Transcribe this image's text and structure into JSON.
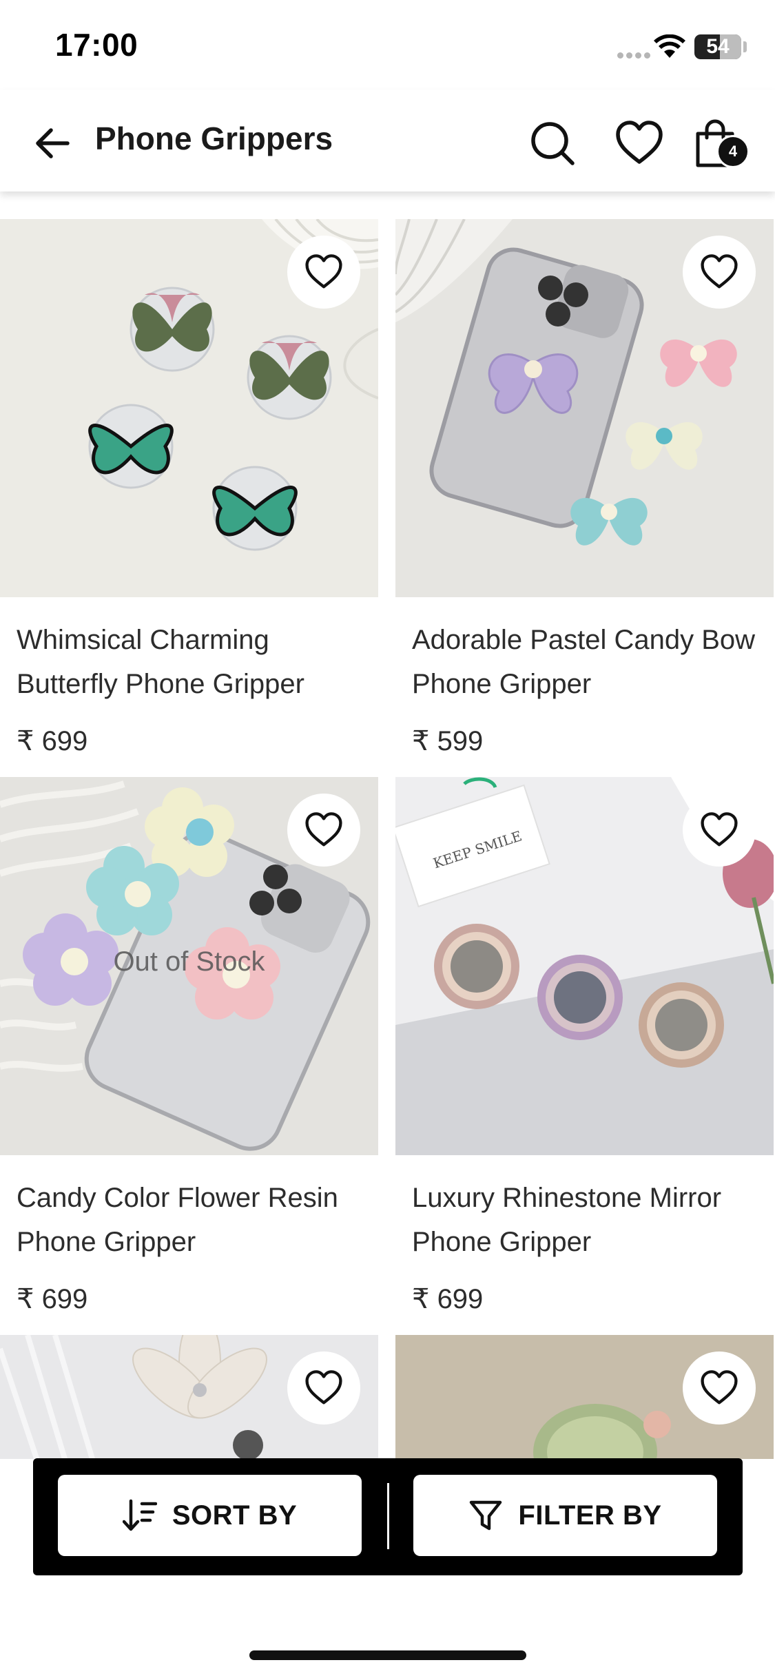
{
  "status_bar": {
    "time": "17:00",
    "battery": "54",
    "battery_level": 0.54
  },
  "header": {
    "title": "Phone Grippers",
    "cart_count": "4",
    "icons": [
      "back-arrow-icon",
      "search-icon",
      "heart-icon",
      "shopping-bag-icon"
    ]
  },
  "products": [
    {
      "name": "Whimsical Charming Butterfly Phone Gripper",
      "price": "₹ 699",
      "status": ""
    },
    {
      "name": "Adorable Pastel Candy Bow Phone Gripper",
      "price": "₹ 599",
      "status": ""
    },
    {
      "name": "Candy Color Flower Resin Phone Gripper",
      "price": "₹ 699",
      "status": "Out of Stock"
    },
    {
      "name": "Luxury Rhinestone Mirror Phone Gripper",
      "price": "₹ 699",
      "status": ""
    }
  ],
  "photo_texts": {
    "note_card": "KEEP SMILE"
  },
  "bottom_bar": {
    "sort_label": "SORT BY",
    "filter_label": "FILTER BY"
  },
  "colors": {
    "accent": "#000000",
    "card_bg": "#ffffff"
  }
}
